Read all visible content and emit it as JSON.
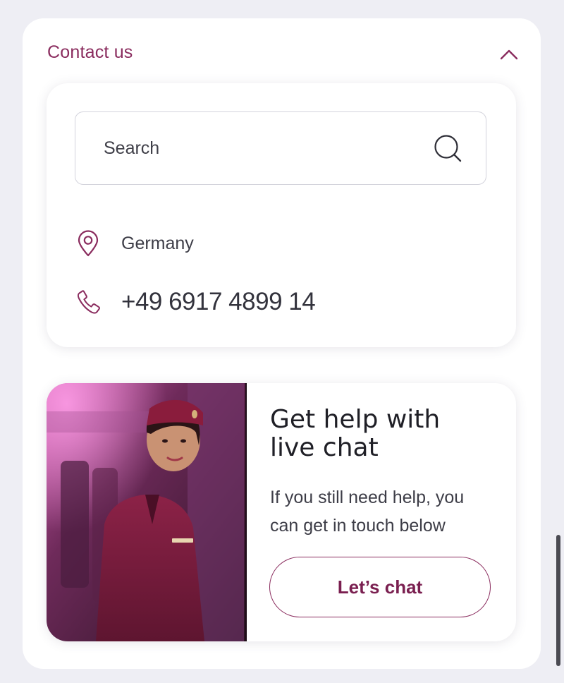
{
  "contact": {
    "title": "Contact us",
    "collapse_icon": "chevron-up-icon",
    "search": {
      "placeholder": "Search",
      "value": "",
      "icon": "search-icon"
    },
    "location": {
      "icon": "map-pin-icon",
      "country": "Germany"
    },
    "phone": {
      "icon": "phone-icon",
      "number": "+49 6917 4899 14"
    }
  },
  "live_chat": {
    "image": "flight-attendant-photo",
    "title_line1": "Get help with",
    "title_line2": "live chat",
    "description": "If you still need help, you can get in touch below",
    "button_label": "Let’s chat"
  },
  "colors": {
    "accent": "#8a2c5e",
    "button_text": "#7a1f50",
    "page_background": "#eeeef4",
    "card_background": "#ffffff"
  }
}
